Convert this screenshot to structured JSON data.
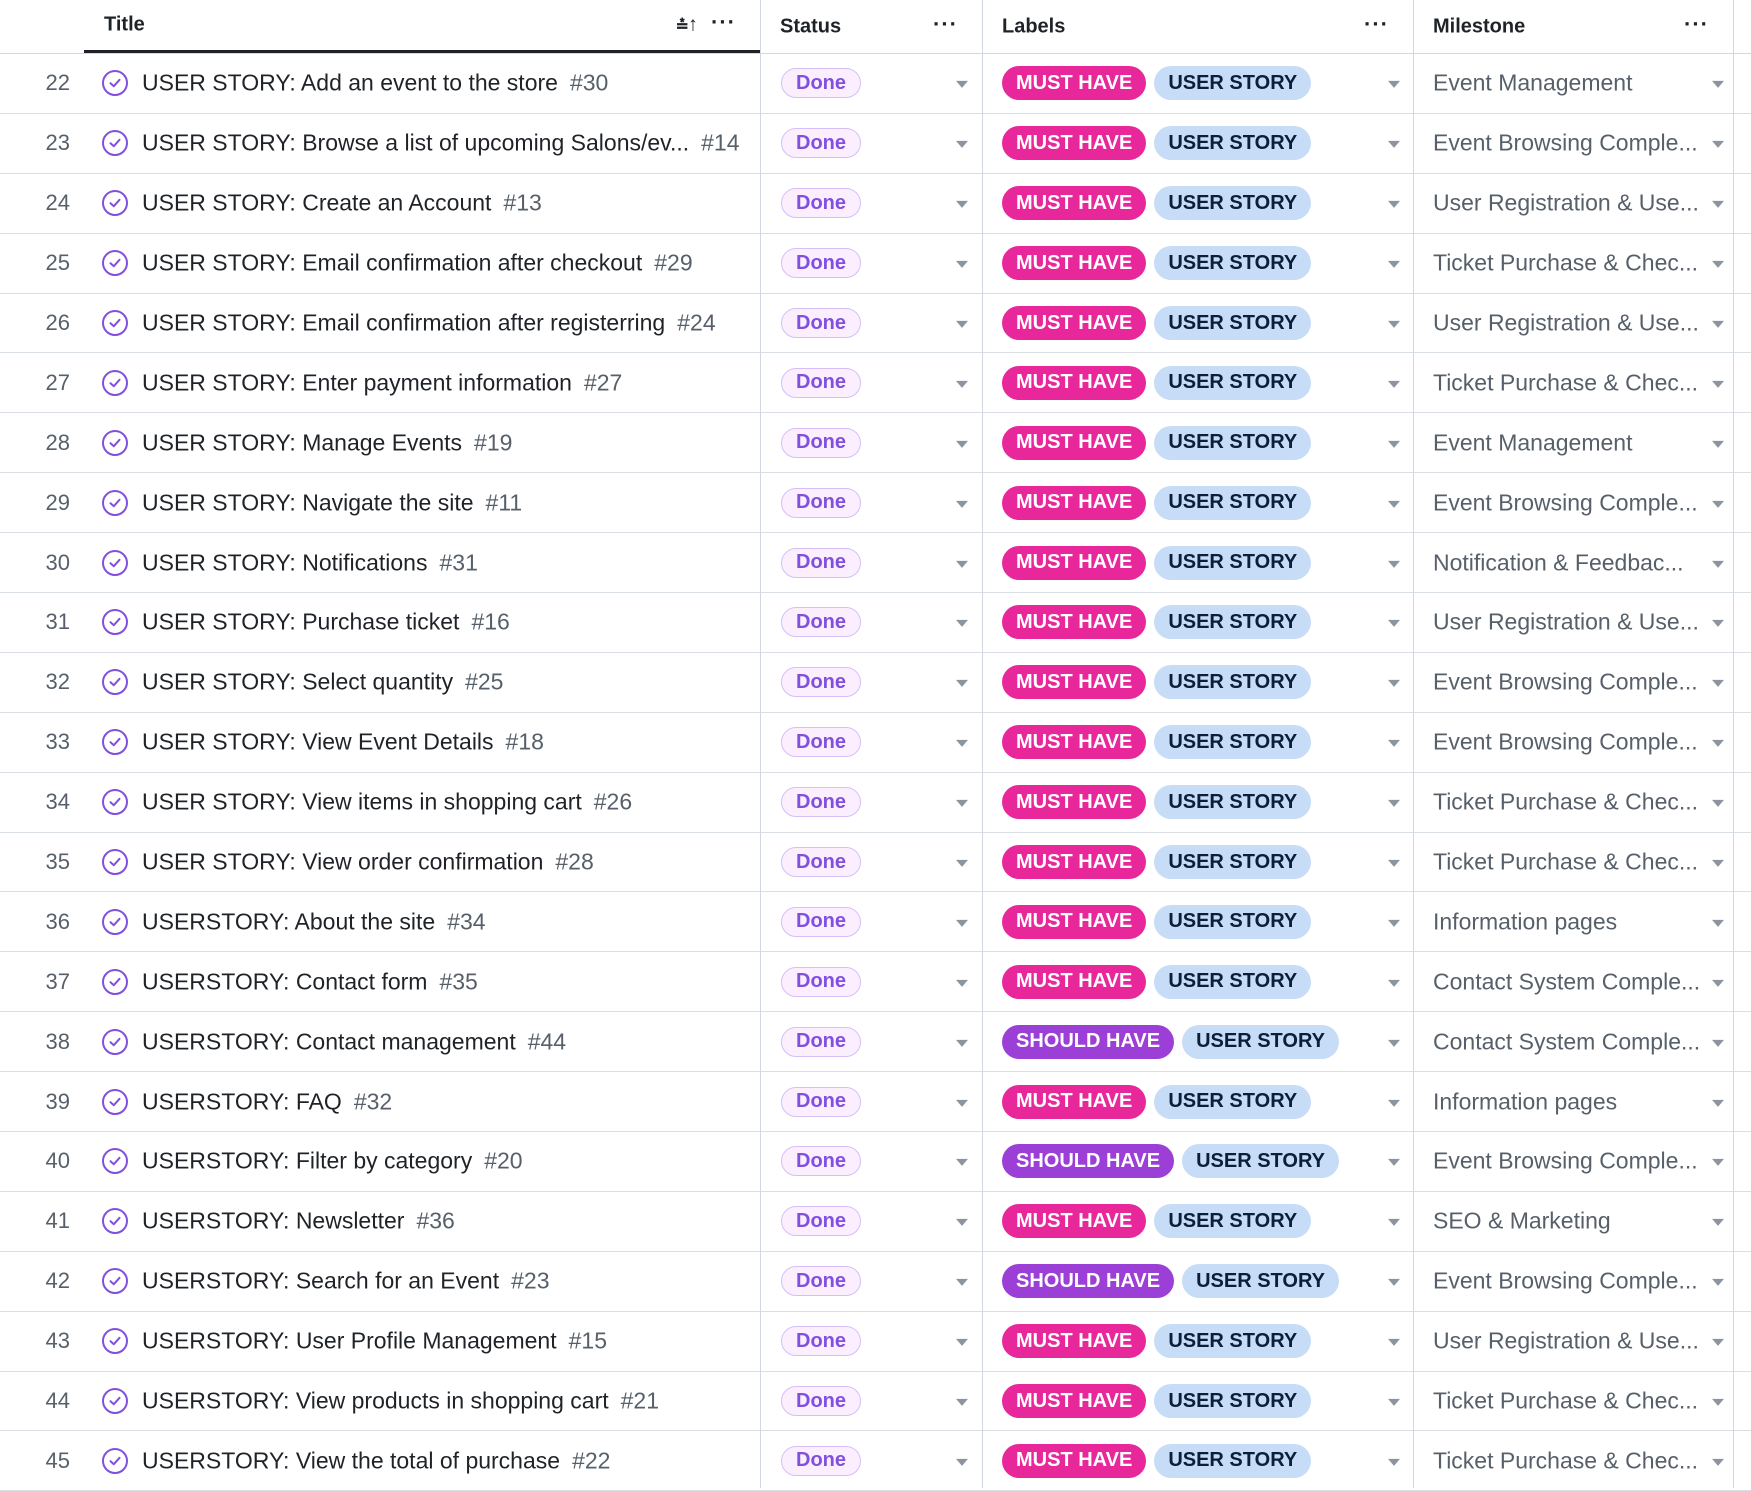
{
  "columns": {
    "title": "Title",
    "status": "Status",
    "labels": "Labels",
    "milestone": "Milestone",
    "more_glyph": "···",
    "sort_glyph": "⩮↑"
  },
  "colors": {
    "status_text": "#8250df",
    "must_have": "#e8279a",
    "should_have": "#9b3fd6",
    "user_story": "#c7dcf7"
  },
  "rows": [
    {
      "num": "22",
      "title": "USER STORY: Add an event to the store",
      "issue": "#30",
      "status": "Done",
      "priority": "MUST HAVE",
      "type": "USER STORY",
      "milestone": "Event Management"
    },
    {
      "num": "23",
      "title": "USER STORY: Browse a list of upcoming Salons/ev...",
      "issue": "#14",
      "status": "Done",
      "priority": "MUST HAVE",
      "type": "USER STORY",
      "milestone": "Event Browsing Comple..."
    },
    {
      "num": "24",
      "title": "USER STORY: Create an Account",
      "issue": "#13",
      "status": "Done",
      "priority": "MUST HAVE",
      "type": "USER STORY",
      "milestone": "User Registration & Use..."
    },
    {
      "num": "25",
      "title": "USER STORY: Email confirmation after checkout",
      "issue": "#29",
      "status": "Done",
      "priority": "MUST HAVE",
      "type": "USER STORY",
      "milestone": "Ticket Purchase & Chec..."
    },
    {
      "num": "26",
      "title": "USER STORY: Email confirmation after registerring",
      "issue": "#24",
      "status": "Done",
      "priority": "MUST HAVE",
      "type": "USER STORY",
      "milestone": "User Registration & Use..."
    },
    {
      "num": "27",
      "title": "USER STORY: Enter payment information",
      "issue": "#27",
      "status": "Done",
      "priority": "MUST HAVE",
      "type": "USER STORY",
      "milestone": "Ticket Purchase & Chec..."
    },
    {
      "num": "28",
      "title": "USER STORY: Manage Events",
      "issue": "#19",
      "status": "Done",
      "priority": "MUST HAVE",
      "type": "USER STORY",
      "milestone": "Event Management"
    },
    {
      "num": "29",
      "title": "USER STORY: Navigate the site",
      "issue": "#11",
      "status": "Done",
      "priority": "MUST HAVE",
      "type": "USER STORY",
      "milestone": "Event Browsing Comple..."
    },
    {
      "num": "30",
      "title": "USER STORY: Notifications",
      "issue": "#31",
      "status": "Done",
      "priority": "MUST HAVE",
      "type": "USER STORY",
      "milestone": "Notification & Feedbac..."
    },
    {
      "num": "31",
      "title": "USER STORY: Purchase ticket",
      "issue": "#16",
      "status": "Done",
      "priority": "MUST HAVE",
      "type": "USER STORY",
      "milestone": "User Registration & Use..."
    },
    {
      "num": "32",
      "title": "USER STORY: Select quantity",
      "issue": "#25",
      "status": "Done",
      "priority": "MUST HAVE",
      "type": "USER STORY",
      "milestone": "Event Browsing Comple..."
    },
    {
      "num": "33",
      "title": "USER STORY: View Event Details",
      "issue": "#18",
      "status": "Done",
      "priority": "MUST HAVE",
      "type": "USER STORY",
      "milestone": "Event Browsing Comple..."
    },
    {
      "num": "34",
      "title": "USER STORY: View items in shopping cart",
      "issue": "#26",
      "status": "Done",
      "priority": "MUST HAVE",
      "type": "USER STORY",
      "milestone": "Ticket Purchase & Chec..."
    },
    {
      "num": "35",
      "title": "USER STORY: View order confirmation",
      "issue": "#28",
      "status": "Done",
      "priority": "MUST HAVE",
      "type": "USER STORY",
      "milestone": "Ticket Purchase & Chec..."
    },
    {
      "num": "36",
      "title": "USERSTORY: About the site",
      "issue": "#34",
      "status": "Done",
      "priority": "MUST HAVE",
      "type": "USER STORY",
      "milestone": "Information pages"
    },
    {
      "num": "37",
      "title": "USERSTORY: Contact form",
      "issue": "#35",
      "status": "Done",
      "priority": "MUST HAVE",
      "type": "USER STORY",
      "milestone": "Contact System Comple..."
    },
    {
      "num": "38",
      "title": "USERSTORY: Contact management",
      "issue": "#44",
      "status": "Done",
      "priority": "SHOULD HAVE",
      "type": "USER STORY",
      "milestone": "Contact System Comple..."
    },
    {
      "num": "39",
      "title": "USERSTORY: FAQ",
      "issue": "#32",
      "status": "Done",
      "priority": "MUST HAVE",
      "type": "USER STORY",
      "milestone": "Information pages"
    },
    {
      "num": "40",
      "title": "USERSTORY: Filter by category",
      "issue": "#20",
      "status": "Done",
      "priority": "SHOULD HAVE",
      "type": "USER STORY",
      "milestone": "Event Browsing Comple..."
    },
    {
      "num": "41",
      "title": "USERSTORY: Newsletter",
      "issue": "#36",
      "status": "Done",
      "priority": "MUST HAVE",
      "type": "USER STORY",
      "milestone": "SEO & Marketing"
    },
    {
      "num": "42",
      "title": "USERSTORY: Search for an Event",
      "issue": "#23",
      "status": "Done",
      "priority": "SHOULD HAVE",
      "type": "USER STORY",
      "milestone": "Event Browsing Comple..."
    },
    {
      "num": "43",
      "title": "USERSTORY: User Profile Management",
      "issue": "#15",
      "status": "Done",
      "priority": "MUST HAVE",
      "type": "USER STORY",
      "milestone": "User Registration & Use..."
    },
    {
      "num": "44",
      "title": "USERSTORY: View products in shopping cart",
      "issue": "#21",
      "status": "Done",
      "priority": "MUST HAVE",
      "type": "USER STORY",
      "milestone": "Ticket Purchase & Chec..."
    },
    {
      "num": "45",
      "title": "USERSTORY: View the total of purchase",
      "issue": "#22",
      "status": "Done",
      "priority": "MUST HAVE",
      "type": "USER STORY",
      "milestone": "Ticket Purchase & Chec..."
    }
  ]
}
